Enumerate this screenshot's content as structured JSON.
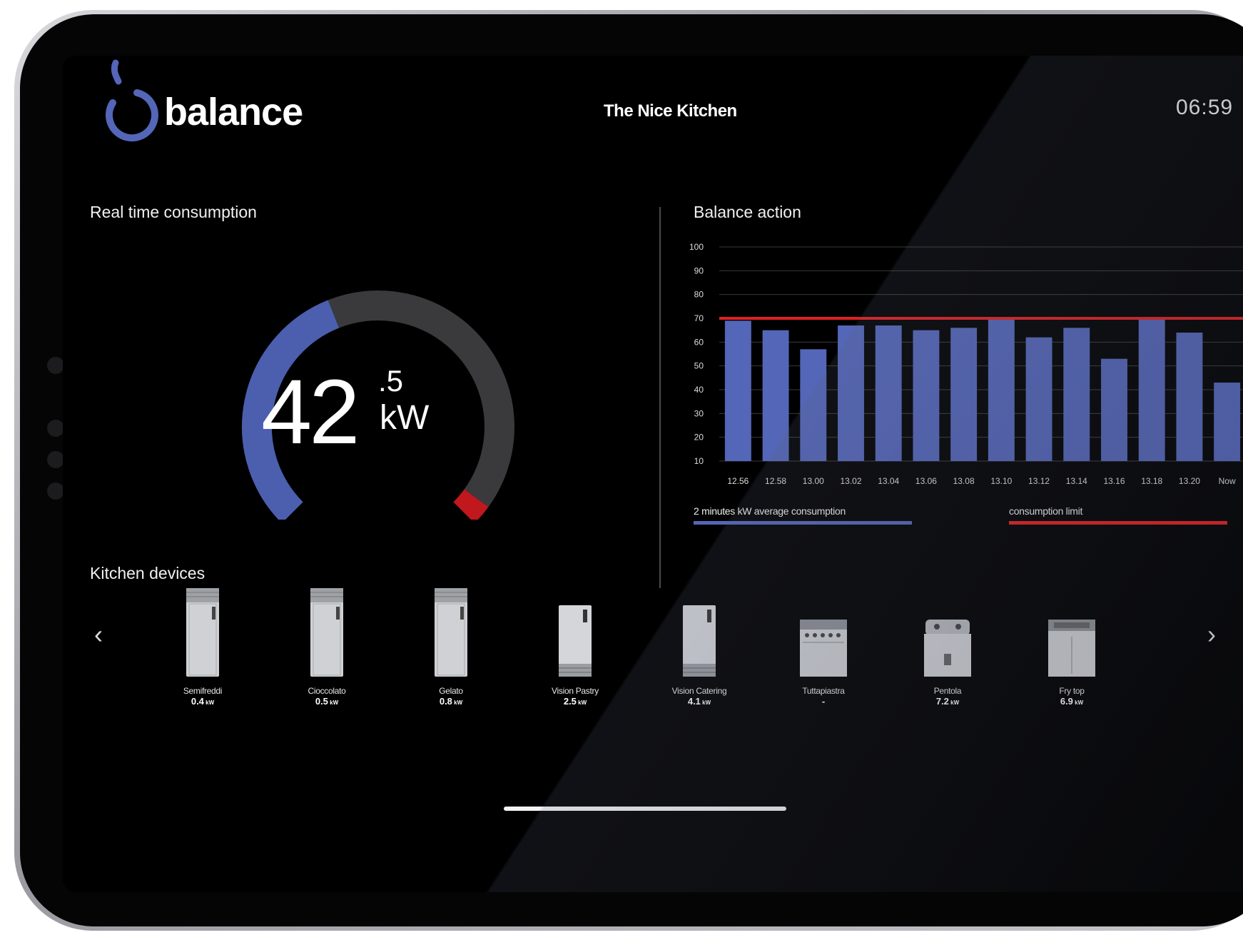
{
  "app": {
    "brand": "balance",
    "kitchen_name": "The Nice Kitchen",
    "time": "06:59"
  },
  "realtime": {
    "title": "Real time consumption",
    "value_int": "42",
    "value_dec": ".5",
    "unit": "kW",
    "gauge_fraction_blue": 0.42,
    "colors": {
      "used": "#4b5fae",
      "remaining": "#3a3a3d",
      "limit": "#c0181c"
    }
  },
  "balance": {
    "title": "Balance action",
    "legend": {
      "avg_label": "2 minutes kW average consumption",
      "limit_label": "consumption limit"
    },
    "colors": {
      "bar": "#5466b8",
      "limit": "#e02020",
      "grid": "#3a3a3a"
    }
  },
  "chart_data": {
    "type": "bar",
    "title": "Balance action",
    "categories": [
      "12.56",
      "12.58",
      "13.00",
      "13.02",
      "13.04",
      "13.06",
      "13.08",
      "13.10",
      "13.12",
      "13.14",
      "13.16",
      "13.18",
      "13.20",
      "Now"
    ],
    "series": [
      {
        "name": "2 minutes kW average consumption",
        "values": [
          69,
          65,
          57,
          67,
          67,
          65,
          66,
          70,
          62,
          66,
          53,
          70,
          64,
          43
        ]
      }
    ],
    "limit": {
      "name": "consumption limit",
      "value": 70
    },
    "yticks": [
      10,
      20,
      30,
      40,
      50,
      60,
      70,
      80,
      90,
      100
    ],
    "ylim": [
      10,
      100
    ],
    "grid": true,
    "legend_position": "bottom"
  },
  "devices": {
    "title": "Kitchen devices",
    "prev_icon": "chevron-left-icon",
    "next_icon": "chevron-right-icon",
    "items": [
      {
        "name": "Semifreddi",
        "value": "0.4",
        "unit": "kW",
        "kind": "tall-fridge"
      },
      {
        "name": "Cioccolato",
        "value": "0.5",
        "unit": "kW",
        "kind": "tall-fridge"
      },
      {
        "name": "Gelato",
        "value": "0.8",
        "unit": "kW",
        "kind": "tall-fridge"
      },
      {
        "name": "Vision Pastry",
        "value": "2.5",
        "unit": "kW",
        "kind": "blast-chiller"
      },
      {
        "name": "Vision Catering",
        "value": "4.1",
        "unit": "kW",
        "kind": "blast-chiller"
      },
      {
        "name": "Tuttapiastra",
        "value": "-",
        "unit": "",
        "kind": "range"
      },
      {
        "name": "Pentola",
        "value": "7.2",
        "unit": "kW",
        "kind": "boiling-pan"
      },
      {
        "name": "Fry top",
        "value": "6.9",
        "unit": "kW",
        "kind": "fry-top"
      }
    ]
  }
}
